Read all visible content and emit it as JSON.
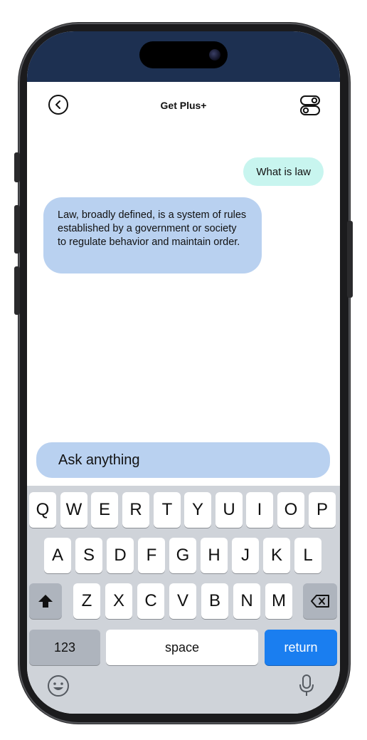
{
  "header": {
    "title": "Get Plus+",
    "back_icon": "chevron-left-circle-icon",
    "settings_icon": "toggles-icon"
  },
  "chat": {
    "messages": [
      {
        "role": "user",
        "text": "What is law"
      },
      {
        "role": "assistant",
        "text": "Law, broadly defined, is a system of rules established by a government or society to regulate behavior and maintain order."
      }
    ]
  },
  "composer": {
    "placeholder": "Ask anything",
    "value": ""
  },
  "keyboard": {
    "row1": [
      "Q",
      "W",
      "E",
      "R",
      "T",
      "Y",
      "U",
      "I",
      "O",
      "P"
    ],
    "row2": [
      "A",
      "S",
      "D",
      "F",
      "G",
      "H",
      "J",
      "K",
      "L"
    ],
    "row3": [
      "Z",
      "X",
      "C",
      "V",
      "B",
      "N",
      "M"
    ],
    "numbers_label": "123",
    "space_label": "space",
    "return_label": "return",
    "icons": [
      "shift-icon",
      "backspace-icon",
      "emoji-icon",
      "microphone-icon"
    ]
  },
  "colors": {
    "status_bar": "#1d3051",
    "user_bubble": "#c8f5ef",
    "assistant_bubble": "#b9d1f0",
    "return_key": "#1a7ef0"
  }
}
